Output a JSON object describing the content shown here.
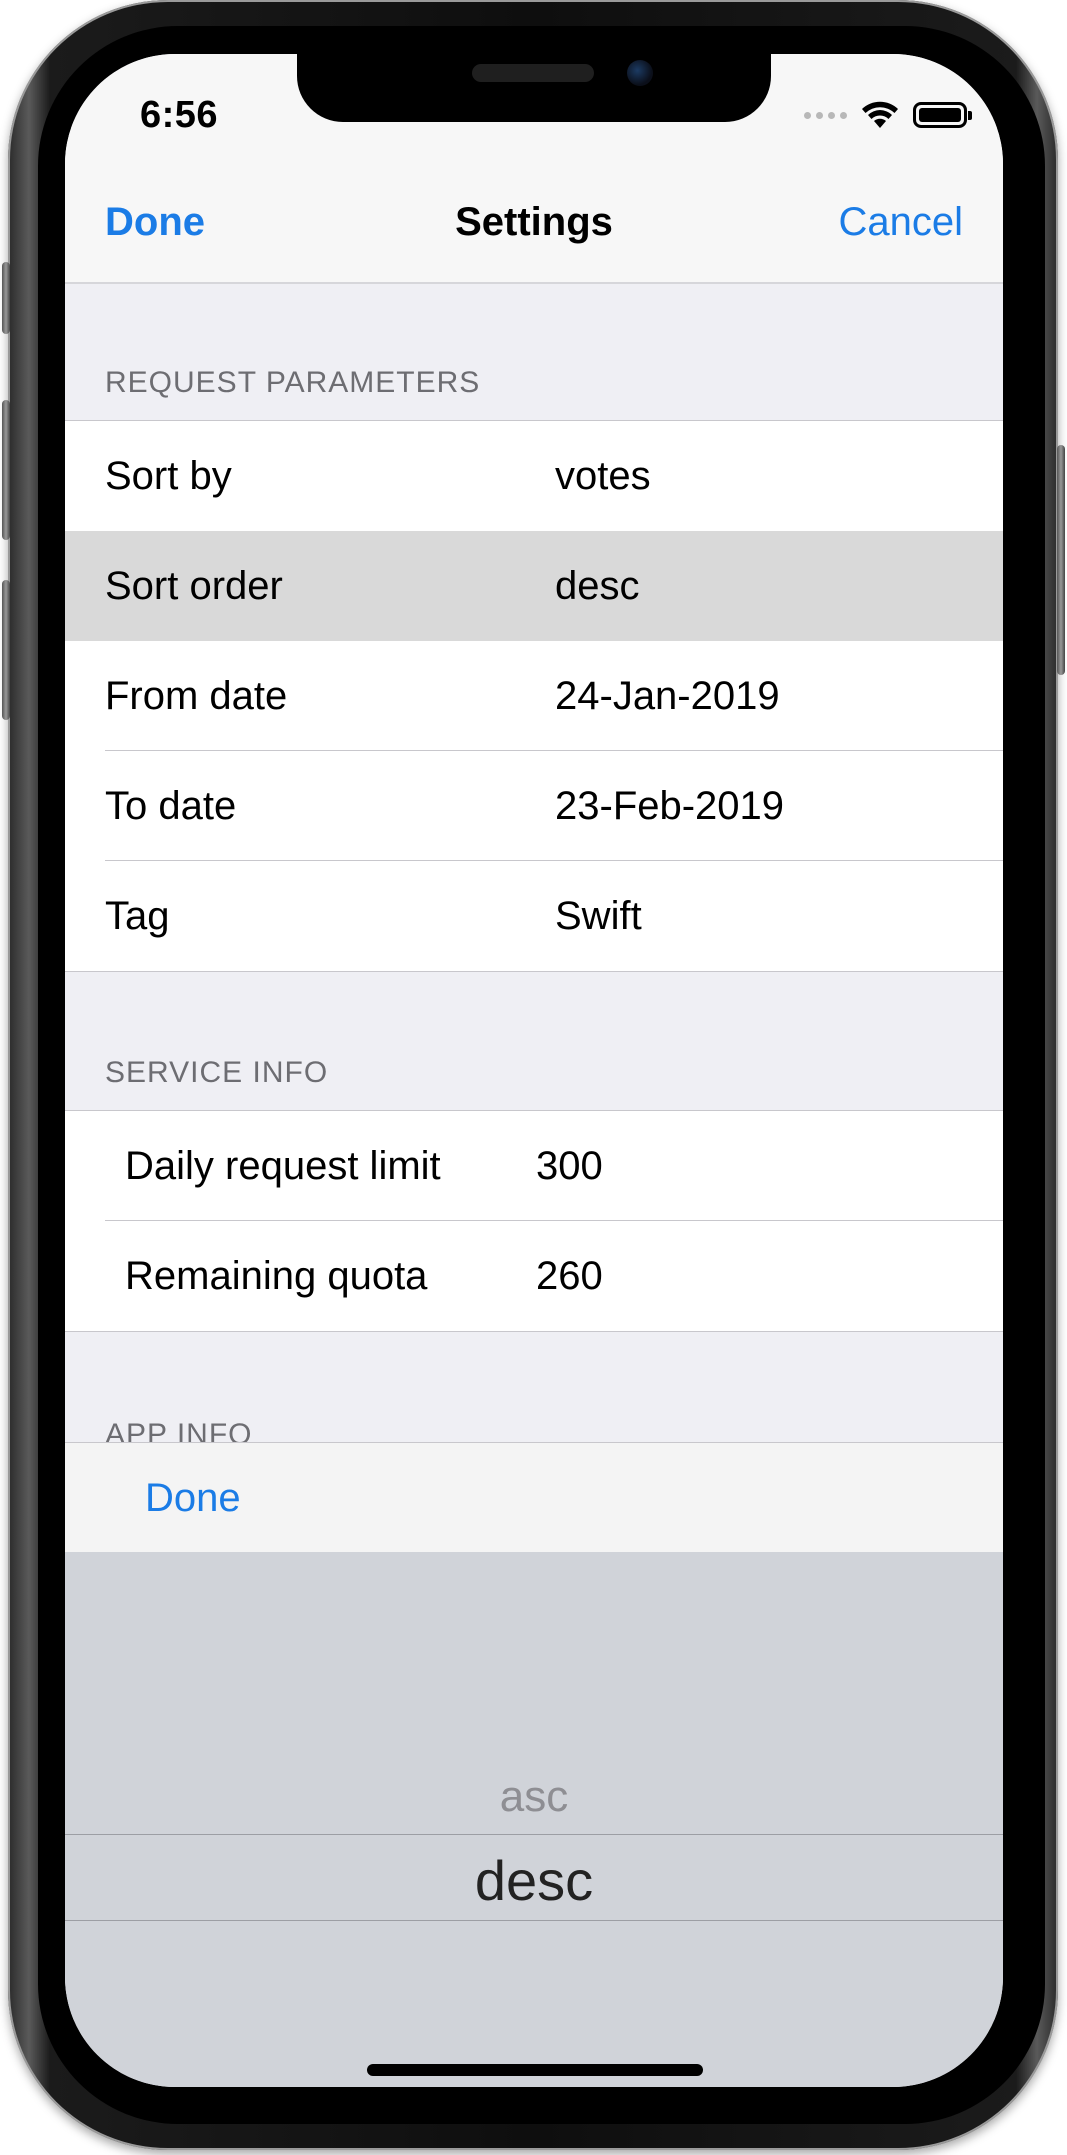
{
  "status_bar": {
    "time": "6:56",
    "icons": [
      "signal-dots-icon",
      "wifi-icon",
      "battery-icon"
    ]
  },
  "nav": {
    "done_label": "Done",
    "title": "Settings",
    "cancel_label": "Cancel"
  },
  "sections": {
    "request_parameters": {
      "header": "REQUEST PARAMETERS",
      "rows": [
        {
          "label": "Sort by",
          "value": "votes"
        },
        {
          "label": "Sort order",
          "value": "desc"
        },
        {
          "label": "From date",
          "value": "24-Jan-2019"
        },
        {
          "label": "To date",
          "value": "23-Feb-2019"
        },
        {
          "label": "Tag",
          "value": "Swift"
        }
      ]
    },
    "service_info": {
      "header": "SERVICE INFO",
      "rows": [
        {
          "label": "Daily request limit",
          "value": "300"
        },
        {
          "label": "Remaining quota",
          "value": "260"
        }
      ]
    },
    "app_info": {
      "header": "APP INFO"
    }
  },
  "picker": {
    "toolbar_done_label": "Done",
    "options": [
      "asc",
      "desc"
    ],
    "selected": "desc"
  },
  "colors": {
    "accent": "#1b7ce6",
    "background": "#efeff4",
    "selected_row": "#d9d9d9",
    "picker_bg": "#d0d3d9"
  }
}
